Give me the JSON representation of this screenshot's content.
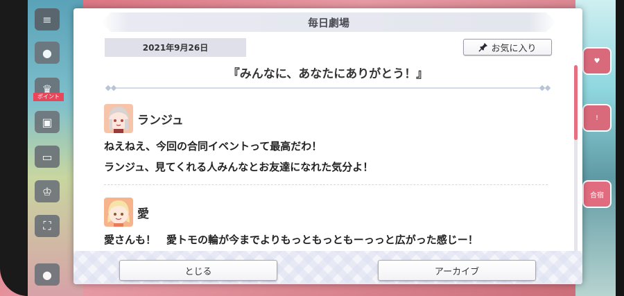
{
  "dialog": {
    "title": "毎日劇場",
    "date": "2021年9月26日",
    "favorite_label": "お気に入り",
    "episode_title": "『みんなに、あなたにありがとう！』",
    "speeches": [
      {
        "speaker": "ランジュ",
        "lines": [
          "ねえねえ、今回の合同イベントって最高だわ！",
          "ランジュ、見てくれる人みんなとお友達になれた気分よ！"
        ]
      },
      {
        "speaker": "愛",
        "lines": [
          "愛さんも！　愛トモの輪が今までよりもっともっともーっっと広がった感じー！"
        ]
      }
    ],
    "close_label": "とじる",
    "archive_label": "アーカイブ"
  },
  "background": {
    "point_badge": "ポイント",
    "right_icon_label": "合宿"
  },
  "colors": {
    "accent": "#e6707f",
    "title_bar": "#e4e6ee",
    "date_box": "#dfe0ea"
  }
}
